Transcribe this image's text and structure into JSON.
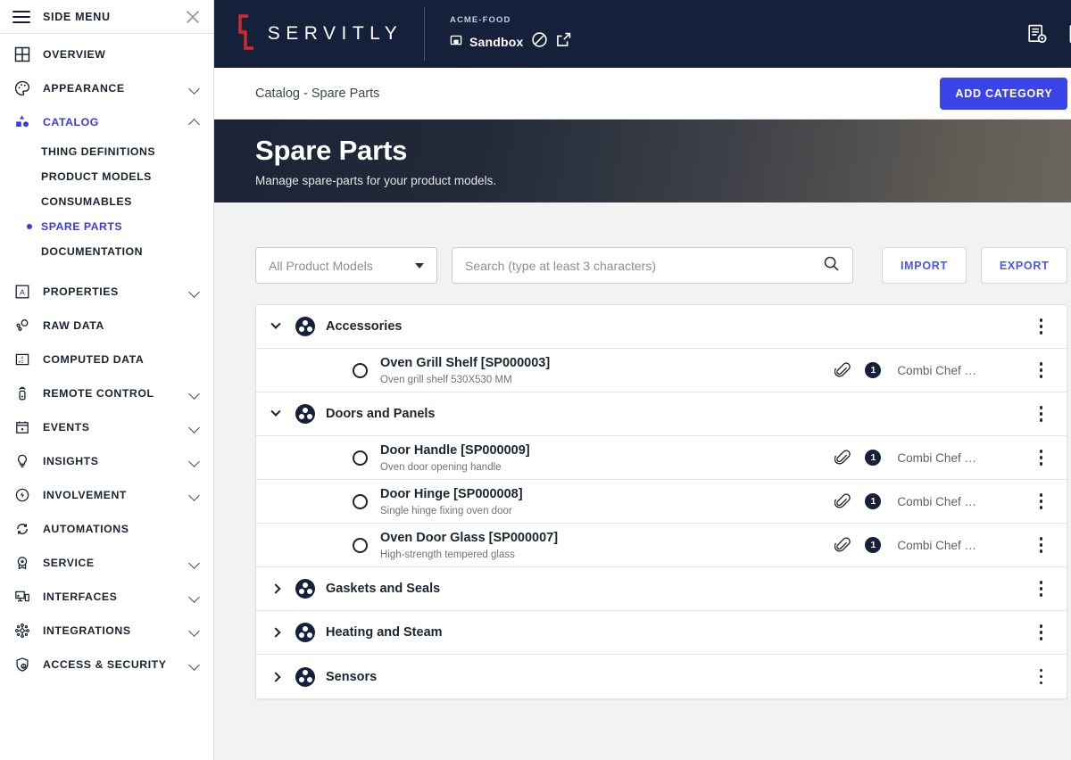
{
  "sidebar": {
    "title": "SIDE MENU",
    "close_icon": "close-icon",
    "menu_icon": "hamburger-icon",
    "items": [
      {
        "label": "OVERVIEW",
        "icon": "grid-icon",
        "expandable": false,
        "active": false
      },
      {
        "label": "APPEARANCE",
        "icon": "palette-icon",
        "expandable": true,
        "active": false
      },
      {
        "label": "CATALOG",
        "icon": "catalog-shapes-icon",
        "expandable": true,
        "active": true,
        "expanded": true
      }
    ],
    "catalog_children": [
      {
        "label": "THING DEFINITIONS",
        "active": false
      },
      {
        "label": "PRODUCT MODELS",
        "active": false
      },
      {
        "label": "CONSUMABLES",
        "active": false
      },
      {
        "label": "SPARE PARTS",
        "active": true
      },
      {
        "label": "DOCUMENTATION",
        "active": false
      }
    ],
    "items_rest": [
      {
        "label": "PROPERTIES",
        "icon": "letter-a-box-icon",
        "expandable": true
      },
      {
        "label": "RAW DATA",
        "icon": "raw-data-icon",
        "expandable": false
      },
      {
        "label": "COMPUTED DATA",
        "icon": "calculator-icon",
        "expandable": false
      },
      {
        "label": "REMOTE CONTROL",
        "icon": "remote-control-icon",
        "expandable": true
      },
      {
        "label": "EVENTS",
        "icon": "calendar-icon",
        "expandable": true
      },
      {
        "label": "INSIGHTS",
        "icon": "lightbulb-icon",
        "expandable": true
      },
      {
        "label": "INVOLVEMENT",
        "icon": "bolt-circle-icon",
        "expandable": true
      },
      {
        "label": "AUTOMATIONS",
        "icon": "refresh-cycle-icon",
        "expandable": false
      },
      {
        "label": "SERVICE",
        "icon": "badge-star-icon",
        "expandable": true
      },
      {
        "label": "INTERFACES",
        "icon": "screen-device-icon",
        "expandable": true
      },
      {
        "label": "INTEGRATIONS",
        "icon": "network-nodes-icon",
        "expandable": true
      },
      {
        "label": "ACCESS & SECURITY",
        "icon": "shield-user-icon",
        "expandable": true
      }
    ]
  },
  "topbar": {
    "brand": "SERVITLY",
    "organization": "ACME-FOOD",
    "environment": "Sandbox",
    "env_box_icon": "box-icon",
    "blocked_icon": "no-entry-icon",
    "external_link_icon": "external-link-icon",
    "notes_icon": "document-settings-icon",
    "account_icon": "account-icon"
  },
  "breadcrumb": {
    "path": "Catalog - Spare Parts",
    "add_category_label": "ADD CATEGORY"
  },
  "hero": {
    "title": "Spare Parts",
    "subtitle": "Manage spare-parts for your product models."
  },
  "toolbar": {
    "product_model_filter": "All Product Models",
    "search_placeholder": "Search (type at least 3 characters)",
    "search_value": "",
    "search_icon": "search-icon",
    "import_label": "IMPORT",
    "export_label": "EXPORT"
  },
  "colors": {
    "accent": "#3a44e8",
    "link": "#4a56e8",
    "topbar_bg": "#15203a",
    "logo_mark": "#d62a2a",
    "page_bg": "#f2f2f3"
  },
  "categories": [
    {
      "name": "Accessories",
      "expanded": true,
      "parts": [
        {
          "title": "Oven Grill Shelf [SP000003]",
          "description": "Oven grill shelf 530X530 MM",
          "attachment_count": "1",
          "model": "Combi Chef …"
        }
      ]
    },
    {
      "name": "Doors and Panels",
      "expanded": true,
      "parts": [
        {
          "title": "Door Handle [SP000009]",
          "description": "Oven door opening handle",
          "attachment_count": "1",
          "model": "Combi Chef …"
        },
        {
          "title": "Door Hinge [SP000008]",
          "description": "Single hinge fixing oven door",
          "attachment_count": "1",
          "model": "Combi Chef …"
        },
        {
          "title": "Oven Door Glass [SP000007]",
          "description": "High-strength tempered glass",
          "attachment_count": "1",
          "model": "Combi Chef …"
        }
      ]
    },
    {
      "name": "Gaskets and Seals",
      "expanded": false,
      "parts": []
    },
    {
      "name": "Heating and Steam",
      "expanded": false,
      "parts": []
    },
    {
      "name": "Sensors",
      "expanded": false,
      "parts": []
    }
  ]
}
